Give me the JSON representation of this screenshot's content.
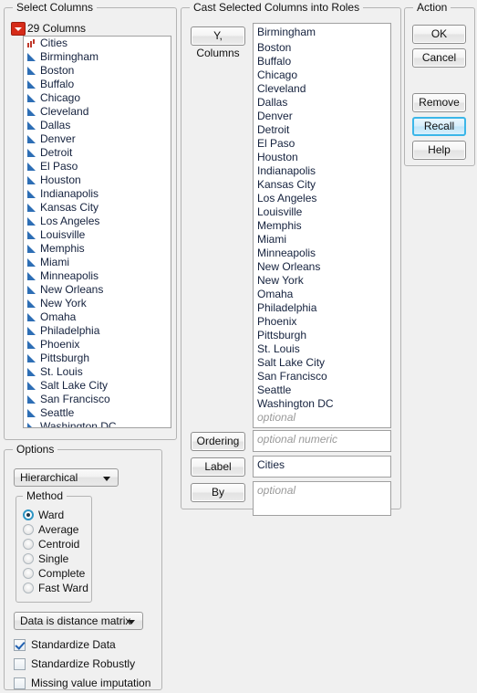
{
  "select_columns": {
    "title": "Select Columns",
    "dropdown_icon": "red-triangle-menu-icon",
    "count_label": "29 Columns",
    "items": [
      {
        "label": "Cities",
        "icon": "nominal-bars-icon"
      },
      {
        "label": "Birmingham",
        "icon": "continuous-triangle-icon"
      },
      {
        "label": "Boston",
        "icon": "continuous-triangle-icon"
      },
      {
        "label": "Buffalo",
        "icon": "continuous-triangle-icon"
      },
      {
        "label": "Chicago",
        "icon": "continuous-triangle-icon"
      },
      {
        "label": "Cleveland",
        "icon": "continuous-triangle-icon"
      },
      {
        "label": "Dallas",
        "icon": "continuous-triangle-icon"
      },
      {
        "label": "Denver",
        "icon": "continuous-triangle-icon"
      },
      {
        "label": "Detroit",
        "icon": "continuous-triangle-icon"
      },
      {
        "label": "El Paso",
        "icon": "continuous-triangle-icon"
      },
      {
        "label": "Houston",
        "icon": "continuous-triangle-icon"
      },
      {
        "label": "Indianapolis",
        "icon": "continuous-triangle-icon"
      },
      {
        "label": "Kansas City",
        "icon": "continuous-triangle-icon"
      },
      {
        "label": "Los Angeles",
        "icon": "continuous-triangle-icon"
      },
      {
        "label": "Louisville",
        "icon": "continuous-triangle-icon"
      },
      {
        "label": "Memphis",
        "icon": "continuous-triangle-icon"
      },
      {
        "label": "Miami",
        "icon": "continuous-triangle-icon"
      },
      {
        "label": "Minneapolis",
        "icon": "continuous-triangle-icon"
      },
      {
        "label": "New Orleans",
        "icon": "continuous-triangle-icon"
      },
      {
        "label": "New York",
        "icon": "continuous-triangle-icon"
      },
      {
        "label": "Omaha",
        "icon": "continuous-triangle-icon"
      },
      {
        "label": "Philadelphia",
        "icon": "continuous-triangle-icon"
      },
      {
        "label": "Phoenix",
        "icon": "continuous-triangle-icon"
      },
      {
        "label": "Pittsburgh",
        "icon": "continuous-triangle-icon"
      },
      {
        "label": "St. Louis",
        "icon": "continuous-triangle-icon"
      },
      {
        "label": "Salt Lake City",
        "icon": "continuous-triangle-icon"
      },
      {
        "label": "San Francisco",
        "icon": "continuous-triangle-icon"
      },
      {
        "label": "Seattle",
        "icon": "continuous-triangle-icon"
      },
      {
        "label": "Washington DC",
        "icon": "continuous-triangle-icon"
      }
    ]
  },
  "roles": {
    "title": "Cast Selected Columns into Roles",
    "y_columns": {
      "button_label": "Y, Columns",
      "values": [
        "Birmingham",
        "Boston",
        "Buffalo",
        "Chicago",
        "Cleveland",
        "Dallas",
        "Denver",
        "Detroit",
        "El Paso",
        "Houston",
        "Indianapolis",
        "Kansas City",
        "Los Angeles",
        "Louisville",
        "Memphis",
        "Miami",
        "Minneapolis",
        "New Orleans",
        "New York",
        "Omaha",
        "Philadelphia",
        "Phoenix",
        "Pittsburgh",
        "St. Louis",
        "Salt Lake City",
        "San Francisco",
        "Seattle",
        "Washington DC"
      ],
      "placeholder": "optional"
    },
    "ordering": {
      "button_label": "Ordering",
      "value": "",
      "placeholder": "optional numeric"
    },
    "label": {
      "button_label": "Label",
      "value": "Cities",
      "placeholder": "optional"
    },
    "by": {
      "button_label": "By",
      "value": "",
      "placeholder": "optional"
    }
  },
  "action": {
    "title": "Action",
    "buttons": [
      {
        "label": "OK",
        "focused": false
      },
      {
        "label": "Cancel",
        "focused": false
      },
      {
        "label": "Remove",
        "focused": false
      },
      {
        "label": "Recall",
        "focused": true
      },
      {
        "label": "Help",
        "focused": false
      }
    ]
  },
  "options": {
    "title": "Options",
    "clustering_method": "Hierarchical",
    "method_group": {
      "title": "Method",
      "selected": "Ward",
      "items": [
        "Ward",
        "Average",
        "Centroid",
        "Single",
        "Complete",
        "Fast Ward"
      ]
    },
    "distance_matrix": "Data is distance matrix",
    "checkboxes": [
      {
        "label": "Standardize Data",
        "checked": true
      },
      {
        "label": "Standardize Robustly",
        "checked": false
      },
      {
        "label": "Missing value imputation",
        "checked": false
      }
    ]
  },
  "colors": {
    "background": "#f0f0f0",
    "focus_border": "#3bb6e8",
    "nominal_icon": "#c0392b",
    "continuous_icon": "#2d6eb5",
    "list_text": "#14213d",
    "menu_red": "#d62b19"
  }
}
